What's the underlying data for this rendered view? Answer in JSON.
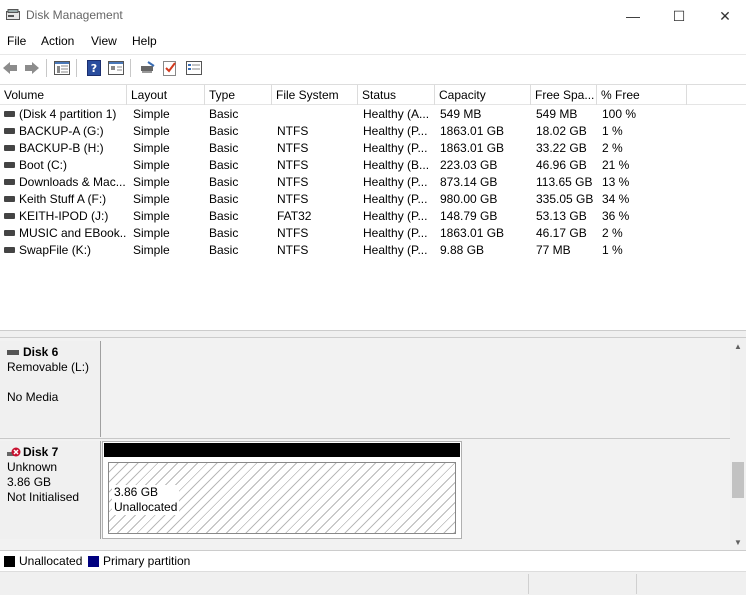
{
  "window": {
    "title": "Disk Management",
    "minimize_glyph": "—",
    "maximize_glyph": "☐",
    "close_glyph": "✕"
  },
  "menu": [
    "File",
    "Action",
    "View",
    "Help"
  ],
  "toolbar": {
    "icons": [
      "back-icon",
      "forward-icon",
      "show-hide-console-tree-icon",
      "help-icon",
      "properties-icon",
      "connect-drive-icon",
      "check-icon",
      "settings-list-icon"
    ]
  },
  "volume_list": {
    "columns": [
      "Volume",
      "Layout",
      "Type",
      "File System",
      "Status",
      "Capacity",
      "Free Spa...",
      "% Free"
    ],
    "rows": [
      {
        "volume": "(Disk 4 partition 1)",
        "layout": "Simple",
        "type": "Basic",
        "fs": "",
        "status": "Healthy (A...",
        "capacity": "549 MB",
        "free": "549 MB",
        "pct": "100 %"
      },
      {
        "volume": "BACKUP-A (G:)",
        "layout": "Simple",
        "type": "Basic",
        "fs": "NTFS",
        "status": "Healthy (P...",
        "capacity": "1863.01 GB",
        "free": "18.02 GB",
        "pct": "1 %"
      },
      {
        "volume": "BACKUP-B (H:)",
        "layout": "Simple",
        "type": "Basic",
        "fs": "NTFS",
        "status": "Healthy (P...",
        "capacity": "1863.01 GB",
        "free": "33.22 GB",
        "pct": "2 %"
      },
      {
        "volume": "Boot (C:)",
        "layout": "Simple",
        "type": "Basic",
        "fs": "NTFS",
        "status": "Healthy (B...",
        "capacity": "223.03 GB",
        "free": "46.96 GB",
        "pct": "21 %"
      },
      {
        "volume": "Downloads & Mac...",
        "layout": "Simple",
        "type": "Basic",
        "fs": "NTFS",
        "status": "Healthy (P...",
        "capacity": "873.14 GB",
        "free": "113.65 GB",
        "pct": "13 %"
      },
      {
        "volume": "Keith Stuff A (F:)",
        "layout": "Simple",
        "type": "Basic",
        "fs": "NTFS",
        "status": "Healthy (P...",
        "capacity": "980.00 GB",
        "free": "335.05 GB",
        "pct": "34 %"
      },
      {
        "volume": "KEITH-IPOD (J:)",
        "layout": "Simple",
        "type": "Basic",
        "fs": "FAT32",
        "status": "Healthy (P...",
        "capacity": "148.79 GB",
        "free": "53.13 GB",
        "pct": "36 %"
      },
      {
        "volume": "MUSIC and EBook...",
        "layout": "Simple",
        "type": "Basic",
        "fs": "NTFS",
        "status": "Healthy (P...",
        "capacity": "1863.01 GB",
        "free": "46.17 GB",
        "pct": "2 %"
      },
      {
        "volume": "SwapFile (K:)",
        "layout": "Simple",
        "type": "Basic",
        "fs": "NTFS",
        "status": "Healthy (P...",
        "capacity": "9.88 GB",
        "free": "77 MB",
        "pct": "1 %"
      }
    ]
  },
  "disks": [
    {
      "name": "Disk 6",
      "line2": "Removable (L:)",
      "line3": "",
      "line4": "No Media"
    },
    {
      "name": "Disk 7",
      "line2": "Unknown",
      "line3": "3.86 GB",
      "line4": "Not Initialised",
      "partition": {
        "size": "3.86 GB",
        "label": "Unallocated"
      }
    }
  ],
  "legend": [
    {
      "label": "Unallocated",
      "color": "#000000"
    },
    {
      "label": "Primary partition",
      "color": "#00007f"
    }
  ]
}
